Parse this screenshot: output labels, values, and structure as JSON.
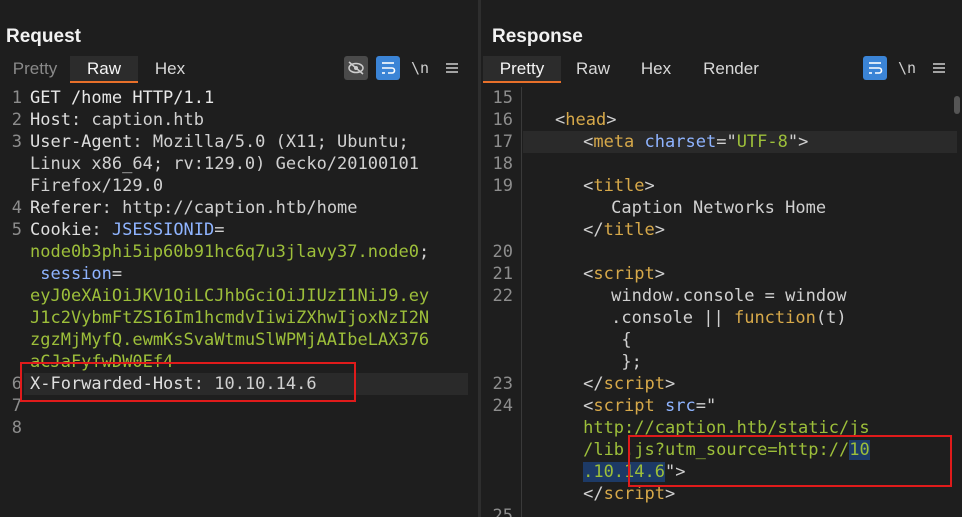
{
  "request": {
    "title": "Request",
    "tabs": [
      "Pretty",
      "Raw",
      "Hex"
    ],
    "active_tab": "Raw",
    "newline_label": "\\n",
    "lines": [
      {
        "num": "1",
        "parts": [
          {
            "t": "GET /home HTTP/1.1",
            "c": "k"
          }
        ]
      },
      {
        "num": "2",
        "parts": [
          {
            "t": "Host",
            "c": "hk"
          },
          {
            "t": ": caption.htb",
            "c": "v"
          }
        ]
      },
      {
        "num": "3",
        "parts": [
          {
            "t": "User-Agent",
            "c": "hk"
          },
          {
            "t": ": Mozilla/5.0 (X11; Ubuntu;",
            "c": "v"
          }
        ]
      },
      {
        "num": "",
        "parts": [
          {
            "t": "Linux x86_64; rv:129.0) Gecko/20100101",
            "c": "v"
          }
        ]
      },
      {
        "num": "",
        "parts": [
          {
            "t": "Firefox/129.0",
            "c": "v"
          }
        ]
      },
      {
        "num": "4",
        "parts": [
          {
            "t": "Referer",
            "c": "hk"
          },
          {
            "t": ": http://caption.htb/home",
            "c": "v"
          }
        ]
      },
      {
        "num": "5",
        "parts": [
          {
            "t": "Cookie",
            "c": "hk"
          },
          {
            "t": ": ",
            "c": "v"
          },
          {
            "t": "JSESSIONID",
            "c": "ck"
          },
          {
            "t": "=",
            "c": "v"
          }
        ]
      },
      {
        "num": "",
        "parts": [
          {
            "t": "node0b3phi5ip60b91hc6q7u3jlavy37.node0",
            "c": "cv"
          },
          {
            "t": ";",
            "c": "v"
          }
        ]
      },
      {
        "num": "",
        "parts": [
          {
            "t": " session",
            "c": "ck"
          },
          {
            "t": "=",
            "c": "v"
          }
        ]
      },
      {
        "num": "",
        "parts": [
          {
            "t": "eyJ0eXAiOiJKV1QiLCJhbGciOiJIUzI1NiJ9.ey",
            "c": "cv"
          }
        ]
      },
      {
        "num": "",
        "parts": [
          {
            "t": "J1c2VybmFtZSI6Im1hcmdvIiwiZXhwIjoxNzI2N",
            "c": "cv"
          }
        ]
      },
      {
        "num": "",
        "parts": [
          {
            "t": "zgzMjMyfQ.ewmKsSvaWtmuSlWPMjAAIbeLAX376",
            "c": "cv"
          }
        ]
      },
      {
        "num": "",
        "parts": [
          {
            "t": "aCJaFyfwDW0Ef4",
            "c": "cv"
          }
        ]
      },
      {
        "num": "6",
        "parts": [
          {
            "t": "X-Forwarded-Host",
            "c": "hk"
          },
          {
            "t": ": 10.10.14.6",
            "c": "v"
          }
        ]
      },
      {
        "num": "7",
        "parts": []
      },
      {
        "num": "8",
        "parts": []
      }
    ]
  },
  "response": {
    "title": "Response",
    "tabs": [
      "Pretty",
      "Raw",
      "Hex",
      "Render"
    ],
    "active_tab": "Pretty",
    "newline_label": "\\n",
    "lines": [
      {
        "num": "15",
        "indent": 0,
        "parts": []
      },
      {
        "num": "16",
        "indent": 2,
        "parts": [
          {
            "t": "<",
            "c": "v"
          },
          {
            "t": "head",
            "c": "tg"
          },
          {
            "t": ">",
            "c": "v"
          }
        ]
      },
      {
        "num": "17",
        "indent": 4,
        "parts": [
          {
            "t": "<",
            "c": "v"
          },
          {
            "t": "meta",
            "c": "tg"
          },
          {
            "t": " ",
            "c": "v"
          },
          {
            "t": "charset",
            "c": "at"
          },
          {
            "t": "=\"",
            "c": "v"
          },
          {
            "t": "UTF-8",
            "c": "av"
          },
          {
            "t": "\">",
            "c": "v"
          }
        ]
      },
      {
        "num": "18",
        "indent": 0,
        "parts": []
      },
      {
        "num": "19",
        "indent": 4,
        "parts": [
          {
            "t": "<",
            "c": "v"
          },
          {
            "t": "title",
            "c": "tg"
          },
          {
            "t": ">",
            "c": "v"
          }
        ]
      },
      {
        "num": "",
        "indent": 6,
        "parts": [
          {
            "t": "Caption Networks Home",
            "c": "v"
          }
        ]
      },
      {
        "num": "",
        "indent": 4,
        "parts": [
          {
            "t": "</",
            "c": "v"
          },
          {
            "t": "title",
            "c": "tg"
          },
          {
            "t": ">",
            "c": "v"
          }
        ]
      },
      {
        "num": "20",
        "indent": 0,
        "parts": []
      },
      {
        "num": "21",
        "indent": 4,
        "parts": [
          {
            "t": "<",
            "c": "v"
          },
          {
            "t": "script",
            "c": "tg"
          },
          {
            "t": ">",
            "c": "v"
          }
        ]
      },
      {
        "num": "22",
        "indent": 6,
        "parts": [
          {
            "t": "window.console = window",
            "c": "v"
          }
        ]
      },
      {
        "num": "",
        "indent": 6,
        "parts": [
          {
            "t": ".console || ",
            "c": "v"
          },
          {
            "t": "function",
            "c": "fn"
          },
          {
            "t": "(t)",
            "c": "v"
          }
        ]
      },
      {
        "num": "",
        "indent": 6,
        "parts": [
          {
            "t": " {",
            "c": "v"
          }
        ]
      },
      {
        "num": "",
        "indent": 6,
        "parts": [
          {
            "t": " };",
            "c": "v"
          }
        ]
      },
      {
        "num": "23",
        "indent": 4,
        "parts": [
          {
            "t": "</",
            "c": "v"
          },
          {
            "t": "script",
            "c": "tg"
          },
          {
            "t": ">",
            "c": "v"
          }
        ]
      },
      {
        "num": "24",
        "indent": 4,
        "parts": [
          {
            "t": "<",
            "c": "v"
          },
          {
            "t": "script",
            "c": "tg"
          },
          {
            "t": " ",
            "c": "v"
          },
          {
            "t": "src",
            "c": "at"
          },
          {
            "t": "=\"",
            "c": "v"
          }
        ]
      },
      {
        "num": "",
        "indent": 4,
        "parts": [
          {
            "t": "http://caption.htb/static/js",
            "c": "av"
          }
        ]
      },
      {
        "num": "",
        "indent": 4,
        "parts": [
          {
            "t": "/lib.js?utm_source=http://",
            "c": "av"
          },
          {
            "t": "10",
            "c": "av sel"
          }
        ]
      },
      {
        "num": "",
        "indent": 4,
        "parts": [
          {
            "t": ".10.14.6",
            "c": "av sel"
          },
          {
            "t": "\">",
            "c": "v"
          }
        ]
      },
      {
        "num": "",
        "indent": 4,
        "parts": [
          {
            "t": "</",
            "c": "v"
          },
          {
            "t": "script",
            "c": "tg"
          },
          {
            "t": ">",
            "c": "v"
          }
        ]
      },
      {
        "num": "25",
        "indent": 0,
        "parts": []
      }
    ]
  },
  "icons": {
    "hide": "eye-slash-icon",
    "wrap": "word-wrap-icon",
    "menu": "hamburger-menu-icon"
  },
  "colors": {
    "accent": "#e8702a",
    "highlight_box": "#e01b1b",
    "button_blue": "#3b84d6"
  }
}
